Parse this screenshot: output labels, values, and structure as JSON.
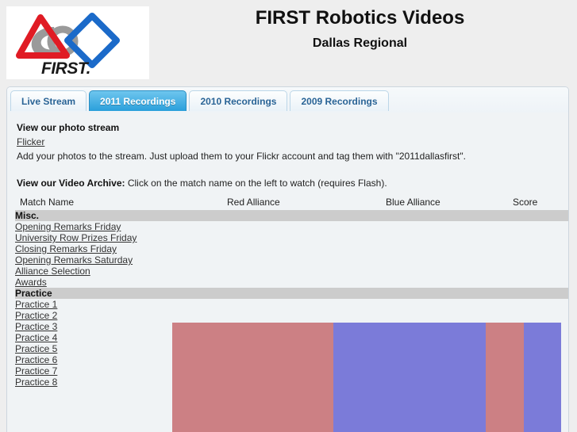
{
  "header": {
    "logo_alt": "FIRST",
    "logo_wordmark": "FIRST.",
    "site_title": "FIRST Robotics Videos",
    "event_title": "Dallas Regional"
  },
  "tabs": [
    {
      "label": "Live Stream",
      "active": false
    },
    {
      "label": "2011 Recordings",
      "active": true
    },
    {
      "label": "2010 Recordings",
      "active": false
    },
    {
      "label": "2009 Recordings",
      "active": false
    }
  ],
  "photo_stream": {
    "heading": "View our photo stream",
    "link_label": "Flicker",
    "description": "Add your photos to the stream. Just upload them to your Flickr account and tag them with \"2011dallasfirst\"."
  },
  "archive": {
    "lead": "View our Video Archive:",
    "instruction": " Click on the match name on the left to watch (requires Flash)."
  },
  "table": {
    "columns": [
      "Match Name",
      "Red Alliance",
      "Blue Alliance",
      "Score"
    ],
    "sections": [
      {
        "title": "Misc.",
        "rows": [
          {
            "name": "Opening Remarks Friday"
          },
          {
            "name": "University Row Prizes Friday"
          },
          {
            "name": "Closing Remarks Friday"
          },
          {
            "name": "Opening Remarks Saturday"
          },
          {
            "name": "Alliance Selection"
          },
          {
            "name": "Awards"
          }
        ]
      },
      {
        "title": "Practice",
        "rows": [
          {
            "name": "Practice 1"
          },
          {
            "name": "Practice 2"
          },
          {
            "name": "Practice 3"
          },
          {
            "name": "Practice 4"
          },
          {
            "name": "Practice 5"
          },
          {
            "name": "Practice 6"
          },
          {
            "name": "Practice 7"
          },
          {
            "name": "Practice 8"
          }
        ]
      }
    ]
  },
  "colors": {
    "red_alliance": "#cc8084",
    "blue_alliance": "#7b7bd9",
    "section_header": "#cccccc",
    "panel_bg": "#f0f3f5",
    "page_bg": "#eeeeee",
    "tab_active": "#2a9fdb",
    "tab_text": "#2a6496"
  }
}
